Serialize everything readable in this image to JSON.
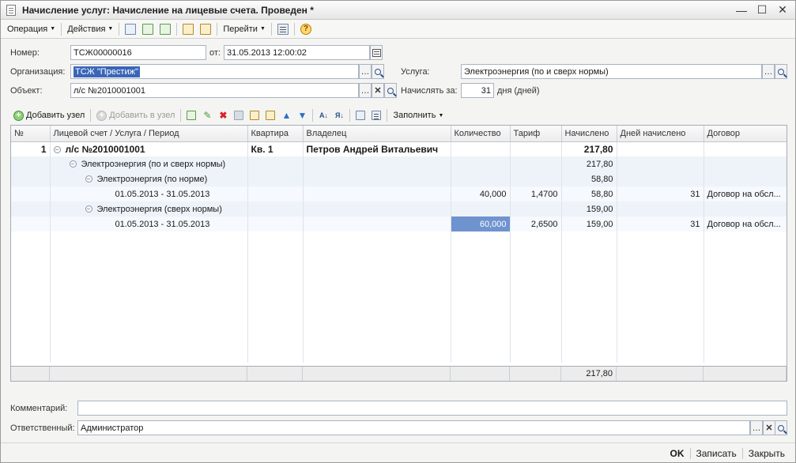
{
  "window": {
    "title": "Начисление услуг: Начисление на лицевые счета. Проведен *"
  },
  "toolbar": {
    "operation": "Операция",
    "actions": "Действия",
    "goto": "Перейти"
  },
  "form": {
    "number_label": "Номер:",
    "number_value": "ТСЖ00000016",
    "from_label": "от:",
    "date_value": "31.05.2013 12:00:02",
    "org_label": "Организация:",
    "org_value": "ТСЖ \"Престиж\"",
    "object_label": "Объект:",
    "object_value": "л/с №2010001001",
    "service_label": "Услуга:",
    "service_value": "Электроэнергия (по и сверх нормы)",
    "charge_for_label": "Начислять за:",
    "charge_for_value": "31",
    "days_label": "дня (дней)"
  },
  "table_toolbar": {
    "add_node": "Добавить узел",
    "add_to_node": "Добавить в узел",
    "fill": "Заполнить"
  },
  "grid": {
    "columns": [
      "№",
      "Лицевой счет / Услуга / Период",
      "Квартира",
      "Владелец",
      "Количество",
      "Тариф",
      "Начислено",
      "Дней начислено",
      "Договор"
    ],
    "rows": [
      {
        "num": "1",
        "name": "л/с №2010001001",
        "flat": "Кв. 1",
        "owner": "Петров Андрей Витальевич",
        "qty": "",
        "tariff": "",
        "charged": "217,80",
        "days": "",
        "contract": ""
      },
      {
        "num": "",
        "name": "Электроэнергия (по и сверх нормы)",
        "flat": "",
        "owner": "",
        "qty": "",
        "tariff": "",
        "charged": "217,80",
        "days": "",
        "contract": ""
      },
      {
        "num": "",
        "name": "Электроэнергия (по норме)",
        "flat": "",
        "owner": "",
        "qty": "",
        "tariff": "",
        "charged": "58,80",
        "days": "",
        "contract": ""
      },
      {
        "num": "",
        "name": "01.05.2013 - 31.05.2013",
        "flat": "",
        "owner": "",
        "qty": "40,000",
        "tariff": "1,4700",
        "charged": "58,80",
        "days": "31",
        "contract": "Договор на обсл..."
      },
      {
        "num": "",
        "name": "Электроэнергия (сверх нормы)",
        "flat": "",
        "owner": "",
        "qty": "",
        "tariff": "",
        "charged": "159,00",
        "days": "",
        "contract": ""
      },
      {
        "num": "",
        "name": "01.05.2013 - 31.05.2013",
        "flat": "",
        "owner": "",
        "qty": "60,000",
        "tariff": "2,6500",
        "charged": "159,00",
        "days": "31",
        "contract": "Договор на обсл..."
      }
    ],
    "total_charged": "217,80"
  },
  "comment": {
    "label": "Комментарий:",
    "value": ""
  },
  "responsible": {
    "label": "Ответственный:",
    "value": "Администратор"
  },
  "bottom": {
    "ok": "OK",
    "save": "Записать",
    "close": "Закрыть"
  }
}
